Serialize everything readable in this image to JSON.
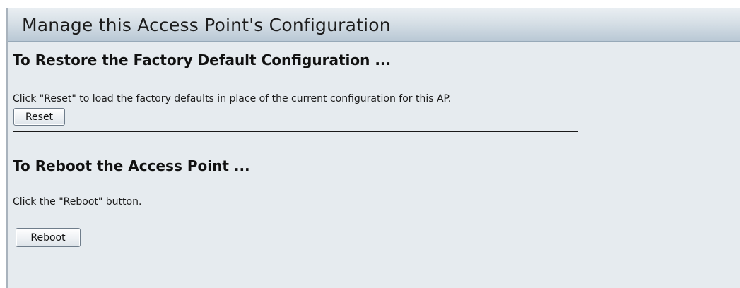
{
  "header": {
    "title": "Manage this Access Point's Configuration"
  },
  "restore_section": {
    "heading": "To Restore the Factory Default Configuration ...",
    "description": "Click \"Reset\" to load the factory defaults in place of the current configuration for this AP.",
    "button_label": "Reset"
  },
  "reboot_section": {
    "heading": "To Reboot the Access Point ...",
    "description": "Click the \"Reboot\" button.",
    "button_label": "Reboot"
  }
}
